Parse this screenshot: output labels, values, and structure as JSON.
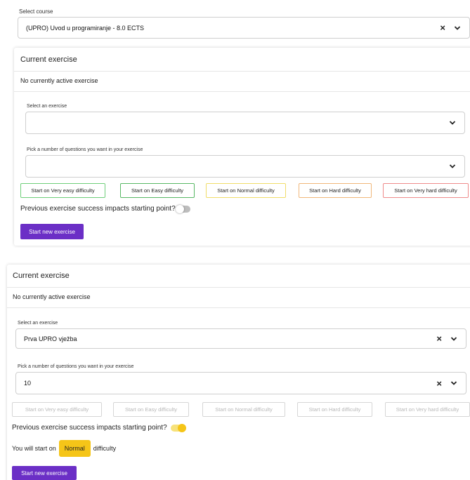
{
  "course": {
    "label": "Select course",
    "value": "(UPRO) Uvod u programiranje - 8.0 ECTS"
  },
  "panel1": {
    "title": "Current exercise",
    "status": "No currently active exercise",
    "exercise_label": "Select an exercise",
    "exercise_value": "",
    "questions_label": "Pick a number of questions you want in your exercise",
    "questions_value": "",
    "difficulties": [
      "Start on Very easy difficulty",
      "Start on Easy difficulty",
      "Start on Normal difficulty",
      "Start on Hard difficulty",
      "Start on Very hard difficulty"
    ],
    "impacts_label": "Previous exercise success impacts starting point?",
    "impacts_on": false,
    "start_button": "Start new exercise"
  },
  "panel2": {
    "title": "Current exercise",
    "status": "No currently active exercise",
    "exercise_label": "Select an exercise",
    "exercise_value": "Prva UPRO vježba",
    "questions_label": "Pick a number of questions you want in your exercise",
    "questions_value": "10",
    "difficulties": [
      "Start on Very easy difficulty",
      "Start on Easy difficulty",
      "Start on Normal difficulty",
      "Start on Hard difficulty",
      "Start on Very hard difficulty"
    ],
    "impacts_label": "Previous exercise success impacts starting point?",
    "impacts_on": true,
    "start_prefix": "You will start on",
    "start_level": "Normal",
    "start_suffix": "difficulty",
    "start_button": "Start new exercise"
  },
  "icons": {
    "clear": "×",
    "dropdown": "chevron-down-icon"
  }
}
